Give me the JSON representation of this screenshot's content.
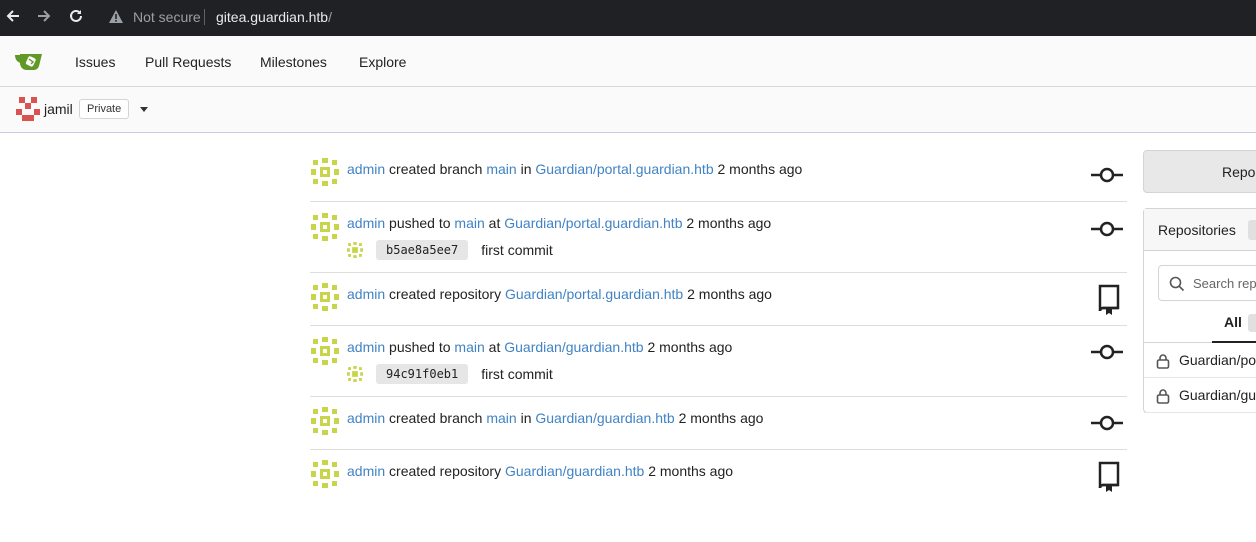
{
  "browser": {
    "security_label": "Not secure",
    "url_host": "gitea.guardian.htb",
    "url_path": "/"
  },
  "nav": {
    "issues": "Issues",
    "pull_requests": "Pull Requests",
    "milestones": "Milestones",
    "explore": "Explore"
  },
  "context": {
    "username": "jamil",
    "visibility": "Private"
  },
  "feed": [
    {
      "user": "admin",
      "action": "created branch",
      "ref": "main",
      "prep": "in",
      "repo": "Guardian/portal.guardian.htb",
      "time": "2 months ago",
      "icon": "commit-icon"
    },
    {
      "user": "admin",
      "action": "pushed to",
      "ref": "main",
      "prep": "at",
      "repo": "Guardian/portal.guardian.htb",
      "time": "2 months ago",
      "icon": "commit-icon",
      "commit": {
        "sha": "b5ae8a5ee7",
        "message": "first commit"
      }
    },
    {
      "user": "admin",
      "action": "created repository",
      "repo": "Guardian/portal.guardian.htb",
      "time": "2 months ago",
      "icon": "repo-icon"
    },
    {
      "user": "admin",
      "action": "pushed to",
      "ref": "main",
      "prep": "at",
      "repo": "Guardian/guardian.htb",
      "time": "2 months ago",
      "icon": "commit-icon",
      "commit": {
        "sha": "94c91f0eb1",
        "message": "first commit"
      }
    },
    {
      "user": "admin",
      "action": "created branch",
      "ref": "main",
      "prep": "in",
      "repo": "Guardian/guardian.htb",
      "time": "2 months ago",
      "icon": "commit-icon"
    },
    {
      "user": "admin",
      "action": "created repository",
      "repo": "Guardian/guardian.htb",
      "time": "2 months ago",
      "icon": "repo-icon"
    }
  ],
  "sidebar": {
    "top_button": "Repos",
    "repos_title": "Repositories",
    "search_placeholder": "Search repo",
    "tab_all": "All",
    "repos": [
      "Guardian/por",
      "Guardian/gu"
    ]
  },
  "colors": {
    "link": "#4183c4",
    "gitea_green": "#609926",
    "avatar_admin": "#c8d44a",
    "avatar_user": "#d9534f"
  }
}
